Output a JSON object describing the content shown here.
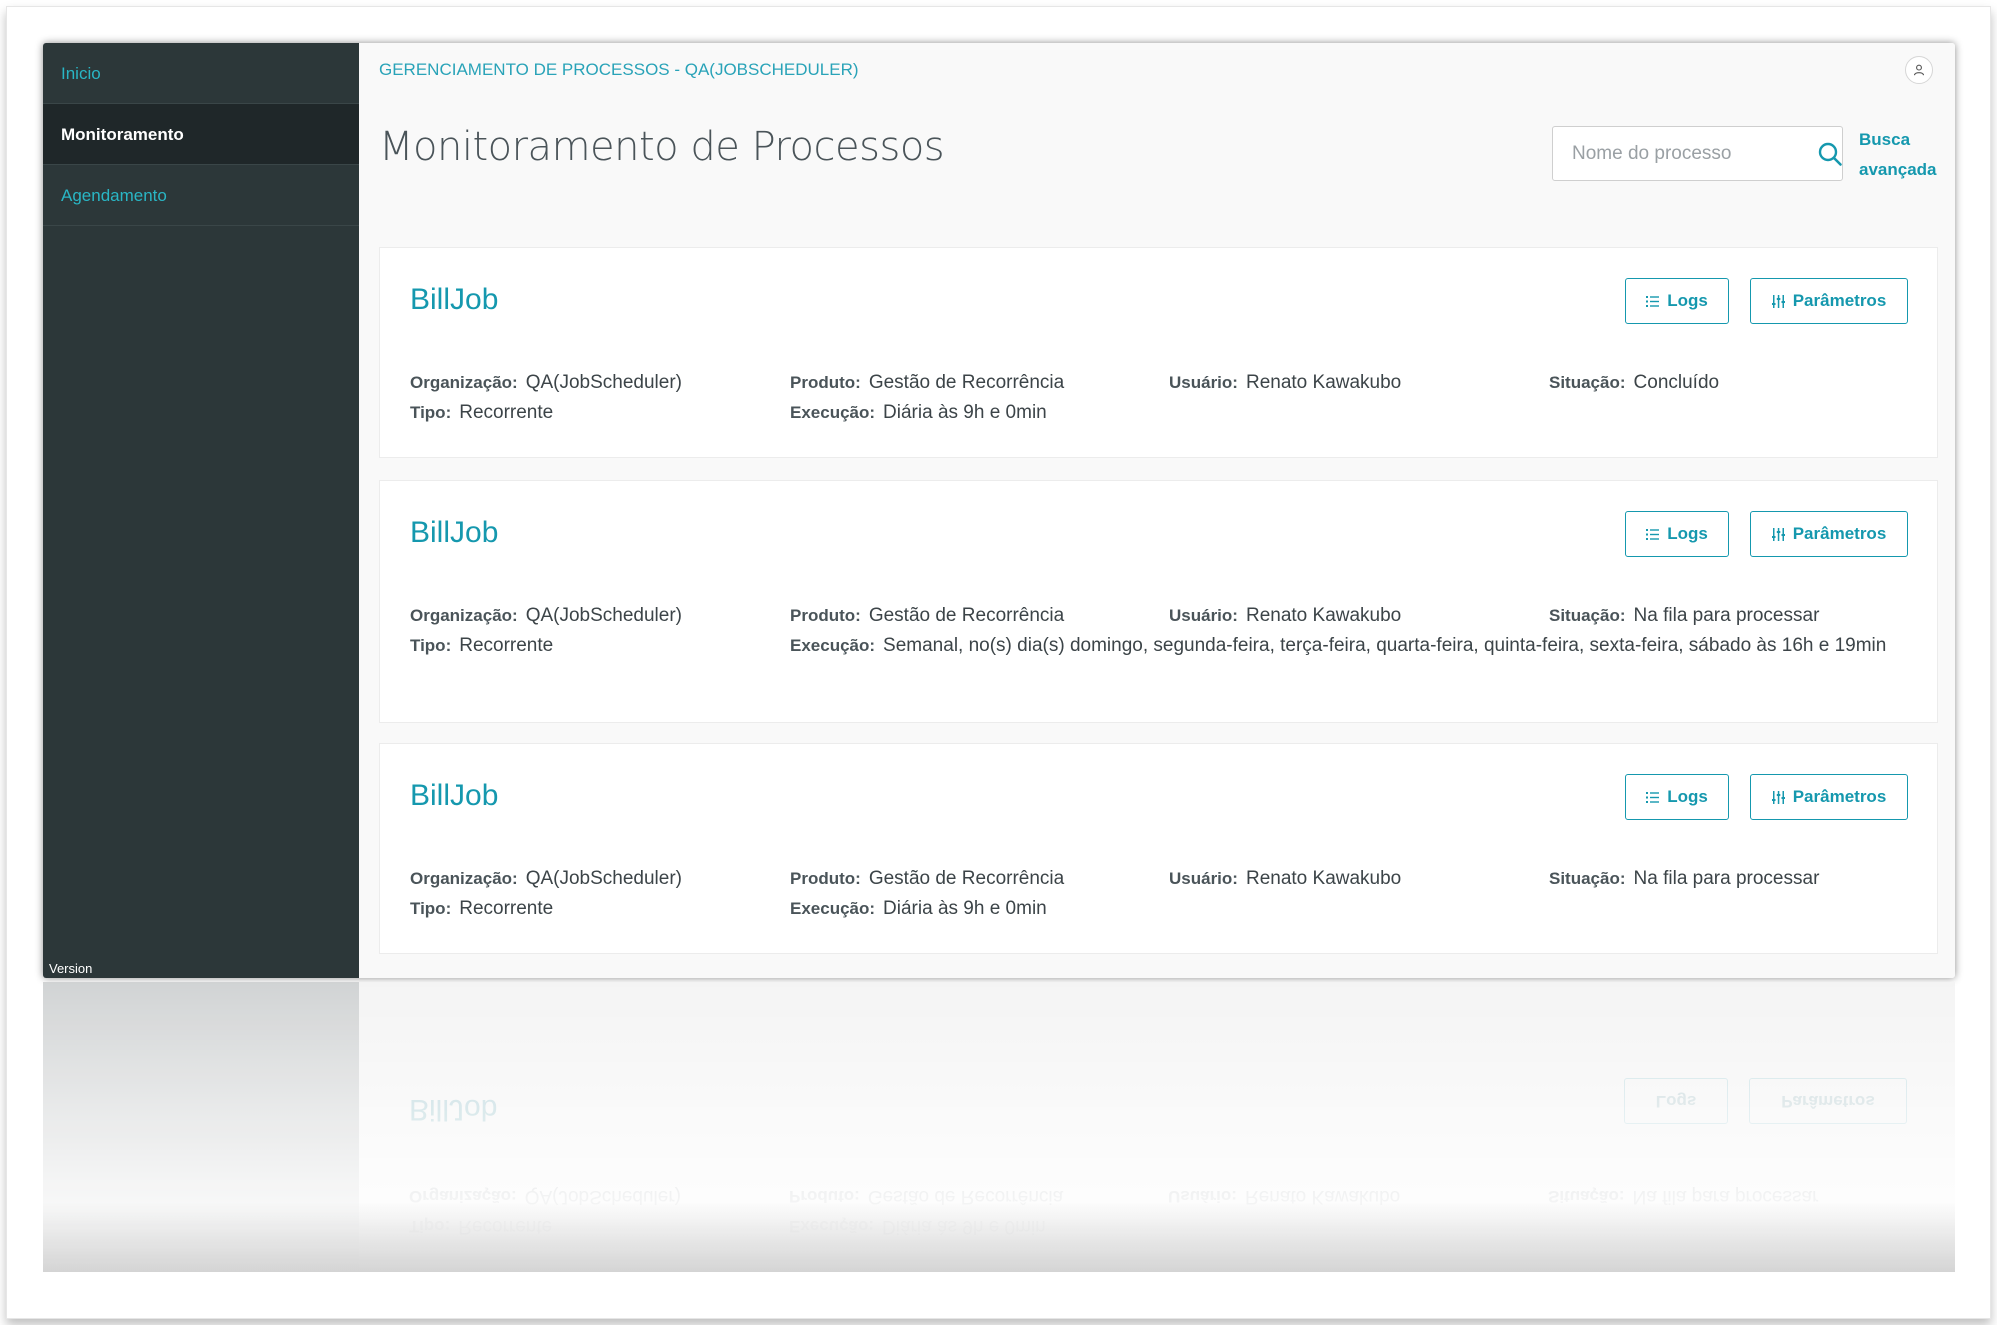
{
  "sidebar": {
    "items": [
      {
        "label": "Inicio"
      },
      {
        "label": "Monitoramento"
      },
      {
        "label": "Agendamento"
      }
    ],
    "version_label": "Version"
  },
  "header": {
    "breadcrumb": "GERENCIAMENTO DE PROCESSOS - QA(JOBSCHEDULER)",
    "title": "Monitoramento de Processos"
  },
  "search": {
    "placeholder": "Nome do processo",
    "advanced_label_line1": "Busca",
    "advanced_label_line2": "avançada"
  },
  "labels": {
    "organizacao": "Organização:",
    "produto": "Produto:",
    "usuario": "Usuário:",
    "situacao": "Situação:",
    "tipo": "Tipo:",
    "execucao": "Execução:",
    "logs": "Logs",
    "parametros": "Parâmetros"
  },
  "jobs": [
    {
      "name": "BillJob",
      "organizacao": "QA(JobScheduler)",
      "produto": "Gestão de Recorrência",
      "usuario": "Renato Kawakubo",
      "situacao": "Concluído",
      "tipo": "Recorrente",
      "execucao": "Diária às 9h e 0min"
    },
    {
      "name": "BillJob",
      "organizacao": "QA(JobScheduler)",
      "produto": "Gestão de Recorrência",
      "usuario": "Renato Kawakubo",
      "situacao": "Na fila para processar",
      "tipo": "Recorrente",
      "execucao": "Semanal, no(s) dia(s) domingo, segunda-feira, terça-feira, quarta-feira, quinta-feira, sexta-feira, sábado às 16h e 19min"
    },
    {
      "name": "BillJob",
      "organizacao": "QA(JobScheduler)",
      "produto": "Gestão de Recorrência",
      "usuario": "Renato Kawakubo",
      "situacao": "Na fila para processar",
      "tipo": "Recorrente",
      "execucao": "Diária às 9h e 0min"
    }
  ],
  "colors": {
    "sidebar_bg": "#2c3739",
    "sidebar_active_bg": "#1f2729",
    "accent": "#1598ae",
    "link": "#29b6c5"
  }
}
